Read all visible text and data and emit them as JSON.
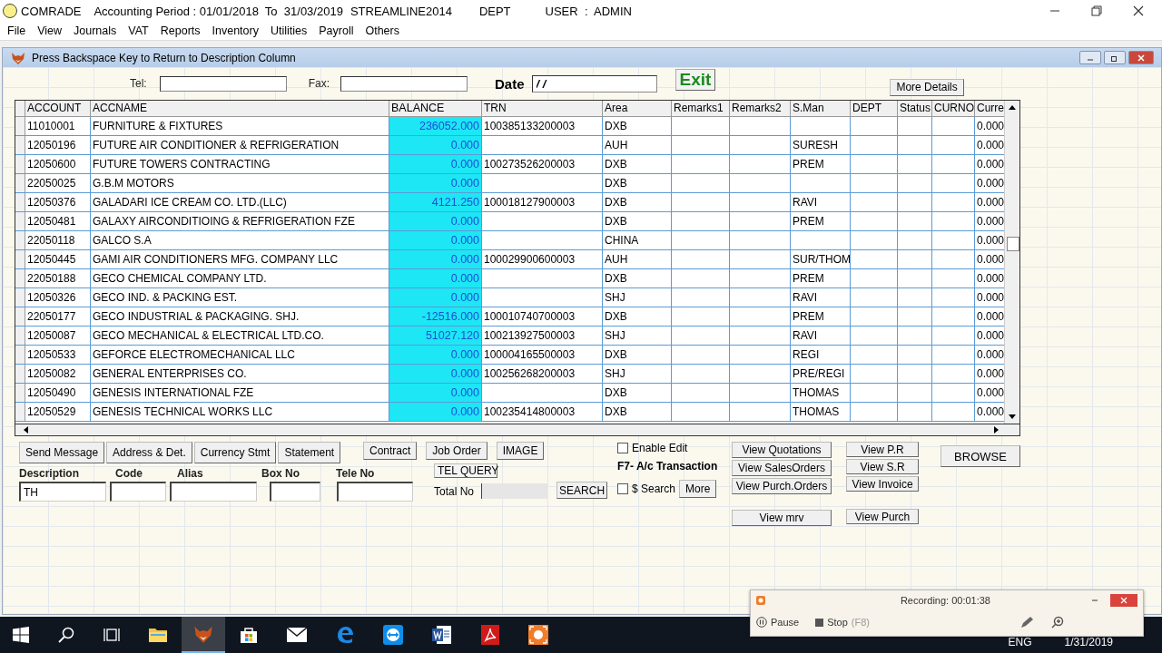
{
  "title_bar": {
    "app": "COMRADE",
    "period": "Accounting Period : 01/01/2018  To  31/03/2019",
    "company": "STREAMLINE2014",
    "dept": "DEPT",
    "user": "USER  :  ADMIN"
  },
  "menu": [
    "File",
    "View",
    "Journals",
    "VAT",
    "Reports",
    "Inventory",
    "Utilities",
    "Payroll",
    "Others"
  ],
  "child_window": {
    "title": "Press  Backspace Key to Return to  Description Column"
  },
  "header_fields": {
    "tel_label": "Tel:",
    "fax_label": "Fax:",
    "date_label": "Date",
    "date_value": "/ /",
    "exit": "Exit",
    "more_details": "More Details"
  },
  "table": {
    "columns": [
      "ACCOUNT",
      "ACCNAME",
      "BALANCE",
      "TRN",
      "Area",
      "Remarks1",
      "Remarks2",
      "S.Man",
      "DEPT",
      "Status",
      "CURNO",
      "Curre"
    ],
    "rows": [
      {
        "account": "11010001",
        "name": "FURNITURE & FIXTURES",
        "balance": "236052.000",
        "trn": "100385133200003",
        "area": "DXB",
        "curre": "0.000"
      },
      {
        "account": "12050196",
        "name": "FUTURE AIR CONDITIONER & REFRIGERATION",
        "balance": "0.000",
        "area": "AUH",
        "sman": "SURESH",
        "curre": "0.000"
      },
      {
        "account": "12050600",
        "name": "FUTURE TOWERS CONTRACTING",
        "balance": "0.000",
        "trn": "100273526200003",
        "area": "DXB",
        "sman": "PREM",
        "curre": "0.000"
      },
      {
        "account": "22050025",
        "name": "G.B.M MOTORS",
        "balance": "0.000",
        "area": "DXB",
        "curre": "0.000"
      },
      {
        "account": "12050376",
        "name": "GALADARI ICE CREAM CO. LTD.(LLC)",
        "balance": "4121.250",
        "trn": "100018127900003",
        "area": "DXB",
        "sman": "RAVI",
        "curre": "0.000"
      },
      {
        "account": "12050481",
        "name": "GALAXY AIRCONDITIOING & REFRIGERATION FZE",
        "balance": "0.000",
        "area": "DXB",
        "sman": "PREM",
        "curre": "0.000"
      },
      {
        "account": "22050118",
        "name": "GALCO  S.A",
        "balance": "0.000",
        "area": "CHINA",
        "curre": "0.000"
      },
      {
        "account": "12050445",
        "name": "GAMI AIR CONDITIONERS MFG. COMPANY LLC",
        "balance": "0.000",
        "trn": "100029900600003",
        "area": "AUH",
        "sman": "SUR/THOM",
        "curre": "0.000"
      },
      {
        "account": "22050188",
        "name": "GECO CHEMICAL COMPANY LTD.",
        "balance": "0.000",
        "area": "DXB",
        "sman": "PREM",
        "curre": "0.000"
      },
      {
        "account": "12050326",
        "name": "GECO IND. & PACKING EST.",
        "balance": "0.000",
        "area": "SHJ",
        "sman": "RAVI",
        "curre": "0.000"
      },
      {
        "account": "22050177",
        "name": "GECO INDUSTRIAL & PACKAGING. SHJ.",
        "balance": "-12516.000",
        "trn": "100010740700003",
        "area": "DXB",
        "sman": "PREM",
        "curre": "0.000"
      },
      {
        "account": "12050087",
        "name": "GECO MECHANICAL & ELECTRICAL LTD.CO.",
        "balance": "51027.120",
        "trn": "100213927500003",
        "area": "SHJ",
        "sman": "RAVI",
        "curre": "0.000"
      },
      {
        "account": "12050533",
        "name": "GEFORCE ELECTROMECHANICAL LLC",
        "balance": "0.000",
        "trn": "100004165500003",
        "area": "DXB",
        "sman": "REGI",
        "curre": "0.000"
      },
      {
        "account": "12050082",
        "name": "GENERAL ENTERPRISES CO.",
        "balance": "0.000",
        "trn": "100256268200003",
        "area": "SHJ",
        "sman": "PRE/REGI",
        "curre": "0.000"
      },
      {
        "account": "12050490",
        "name": "GENESIS INTERNATIONAL FZE",
        "balance": "0.000",
        "area": "DXB",
        "sman": "THOMAS",
        "curre": "0.000"
      },
      {
        "account": "12050529",
        "name": "GENESIS TECHNICAL WORKS LLC",
        "balance": "0.000",
        "trn": "100235414800003",
        "area": "DXB",
        "sman": "THOMAS",
        "curre": "0.000"
      }
    ]
  },
  "tab_buttons": [
    "Send Message",
    "Address & Det.",
    "Currency Stmt",
    "Statement"
  ],
  "form_fields": [
    {
      "label": "Description",
      "value": "TH"
    },
    {
      "label": "Code"
    },
    {
      "label": "Alias"
    },
    {
      "label": "Box No"
    },
    {
      "label": "Tele No"
    }
  ],
  "middle_buttons": [
    "Contract",
    "Job Order",
    "IMAGE"
  ],
  "tel_query": {
    "button": "TEL QUERY",
    "total_label": "Total No",
    "search": "SEARCH"
  },
  "options": {
    "enable_edit": {
      "label": "Enable Edit",
      "checked": false
    },
    "f7_hint": "F7- A/c Transaction",
    "dollar_search": {
      "label": "$ Search",
      "checked": false
    },
    "more": "More"
  },
  "view_buttons_1": [
    "View Quotations",
    "View SalesOrders",
    "View Purch.Orders",
    "View mrv"
  ],
  "view_buttons_2": [
    "View  P.R",
    "View  S.R",
    "View Invoice",
    "View Purch"
  ],
  "browse": "BROWSE",
  "recorder": {
    "status": "Recording:  00:01:38",
    "pause": "Pause",
    "stop": "Stop",
    "stop_key": "(F8)"
  },
  "taskbar": {
    "language": "ENG",
    "date": "1/31/2019"
  }
}
